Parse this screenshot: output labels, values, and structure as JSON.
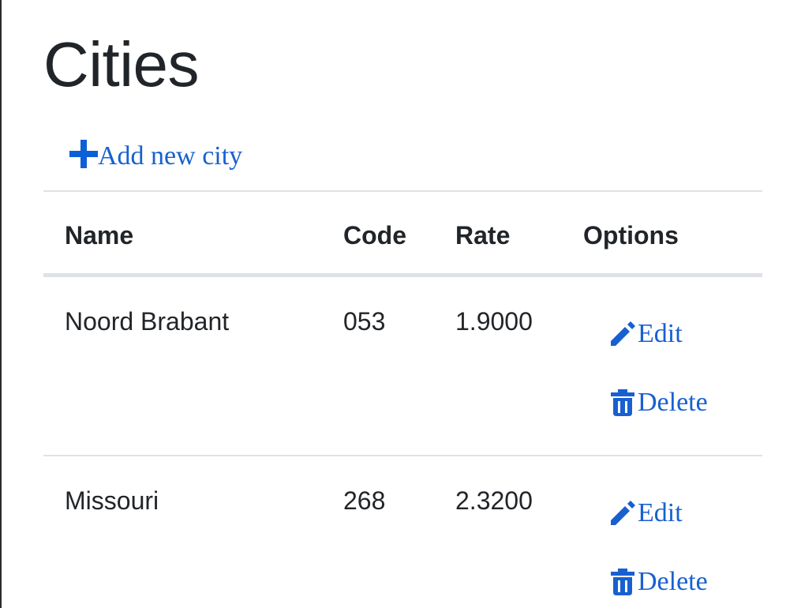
{
  "page": {
    "title": "Cities",
    "add_link": {
      "label": "Add new city",
      "icon": "plus-icon"
    }
  },
  "table": {
    "headers": {
      "name": "Name",
      "code": "Code",
      "rate": "Rate",
      "options": "Options"
    },
    "rows": [
      {
        "name": "Noord Brabant",
        "code": "053",
        "rate": "1.9000",
        "edit_label": "Edit",
        "delete_label": "Delete"
      },
      {
        "name": "Missouri",
        "code": "268",
        "rate": "2.3200",
        "edit_label": "Edit",
        "delete_label": "Delete"
      }
    ]
  },
  "colors": {
    "link": "#1860d0",
    "text": "#212529",
    "border": "#dee2e6"
  }
}
